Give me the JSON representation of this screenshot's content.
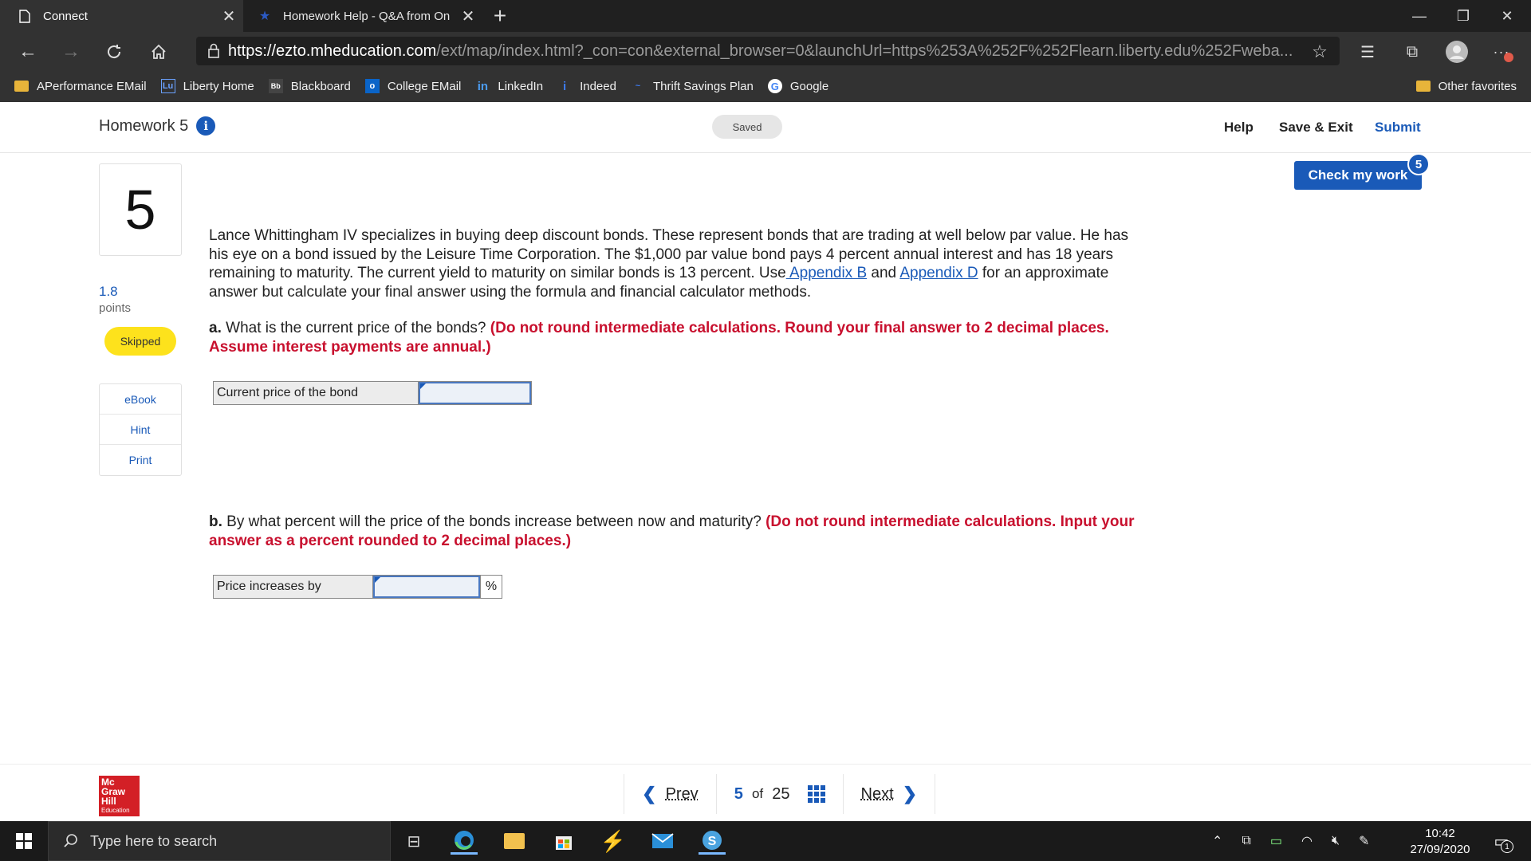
{
  "browser": {
    "tabs": [
      {
        "title": "Connect",
        "active": true
      },
      {
        "title": "Homework Help - Q&A from On",
        "active": false
      }
    ],
    "url_host": "https://ezto.mheducation.com",
    "url_path": "/ext/map/index.html?_con=con&external_browser=0&launchUrl=https%253A%252F%252Flearn.liberty.edu%252Fweba...",
    "favorites": [
      {
        "label": "APerformance EMail",
        "icon": "folder-icon"
      },
      {
        "label": "Liberty Home",
        "icon": "liberty-icon"
      },
      {
        "label": "Blackboard",
        "icon": "blackboard-icon"
      },
      {
        "label": "College EMail",
        "icon": "outlook-icon"
      },
      {
        "label": "LinkedIn",
        "icon": "linkedin-icon"
      },
      {
        "label": "Indeed",
        "icon": "indeed-icon"
      },
      {
        "label": "Thrift Savings Plan",
        "icon": "tsp-icon"
      },
      {
        "label": "Google",
        "icon": "google-icon"
      }
    ],
    "other_favorites": "Other favorites"
  },
  "header": {
    "title": "Homework 5",
    "status": "Saved",
    "help": "Help",
    "save_exit": "Save & Exit",
    "submit": "Submit"
  },
  "question": {
    "number": "5",
    "points_value": "1.8",
    "points_label": "points",
    "status": "Skipped",
    "tools": [
      "eBook",
      "Hint",
      "Print"
    ],
    "check_label": "Check my work",
    "check_count": "5",
    "text_1": "Lance Whittingham IV specializes in buying deep discount bonds. These represent bonds that are trading at well below par value. He has his eye on a bond issued by the Leisure Time Corporation. The $1,000 par value bond pays 4 percent annual interest and has 18 years remaining to maturity. The current yield to maturity on similar bonds is 13 percent. Use",
    "link_b": " Appendix B",
    "text_and": " and ",
    "link_d": "Appendix D",
    "text_2": " for an approximate answer but calculate your final answer using the formula and financial calculator methods.",
    "part_a": {
      "label": "a.",
      "question": " What is the current price of the bonds? ",
      "instructions": "(Do not round intermediate calculations. Round your final answer to 2 decimal places. Assume interest payments are annual.)",
      "field_label": "Current price of the bond",
      "value": ""
    },
    "part_b": {
      "label": "b.",
      "question": " By what percent will the price of the bonds increase between now and maturity? ",
      "instructions": "(Do not round intermediate calculations. Input your answer as a percent rounded to 2 decimal places.)",
      "field_label": "Price increases by",
      "unit": "%",
      "value": ""
    }
  },
  "footer": {
    "logo_line1": "Mc",
    "logo_line2": "Graw",
    "logo_line3": "Hill",
    "logo_line4": "Education",
    "prev": "Prev",
    "current": "5",
    "of": "of",
    "total": "25",
    "next": "Next"
  },
  "taskbar": {
    "search_placeholder": "Type here to search",
    "time": "10:42",
    "date": "27/09/2020",
    "notifications": "1"
  },
  "colors": {
    "accent": "#1a5ab8",
    "instruction_red": "#c8102e",
    "skipped_yellow": "#fde21c",
    "brand_red": "#d31f26"
  }
}
